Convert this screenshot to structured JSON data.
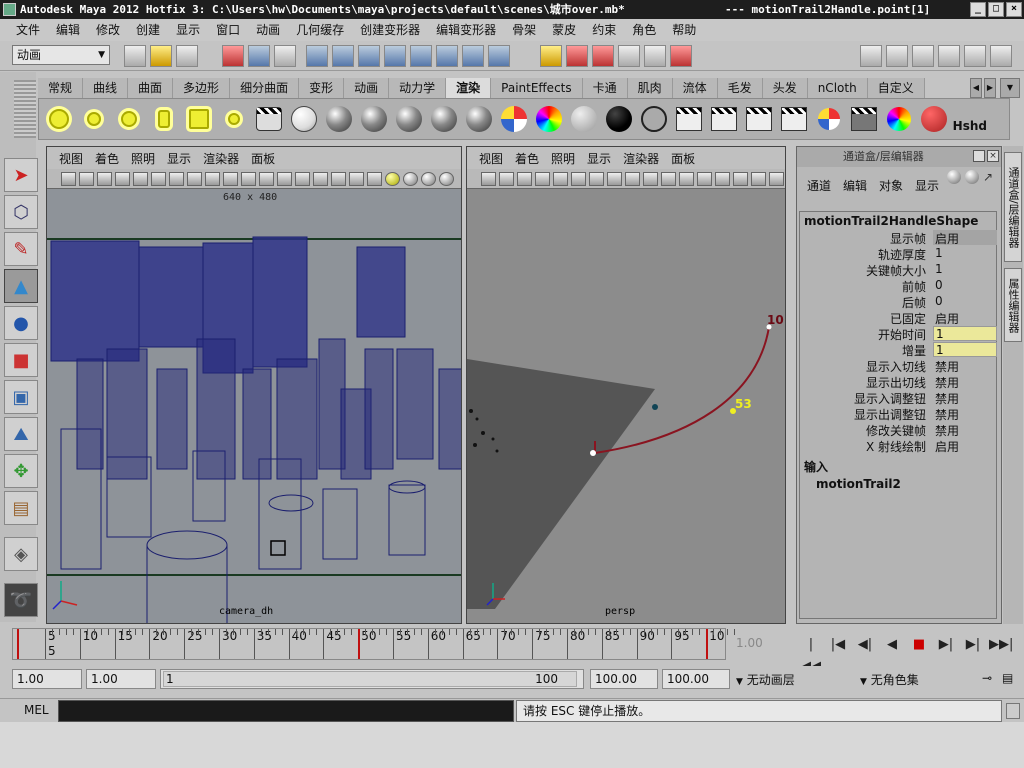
{
  "window": {
    "title": "Autodesk Maya 2012 Hotfix 3: C:\\Users\\hw\\Documents\\maya\\projects\\default\\scenes\\城市over.mb*",
    "title_extra": "---    motionTrail2Handle.point[1]",
    "controls": [
      "_",
      "□",
      "×"
    ]
  },
  "watermark": "新金桥 刘件通",
  "menu": [
    "文件",
    "编辑",
    "修改",
    "创建",
    "显示",
    "窗口",
    "动画",
    "几何缓存",
    "创建变形器",
    "编辑变形器",
    "骨架",
    "蒙皮",
    "约束",
    "角色",
    "帮助"
  ],
  "status_line": {
    "mode": "动画"
  },
  "shelf": {
    "tabs": [
      "常规",
      "曲线",
      "曲面",
      "多边形",
      "细分曲面",
      "变形",
      "动画",
      "动力学",
      "渲染",
      "PaintEffects",
      "卡通",
      "肌肉",
      "流体",
      "毛发",
      "头发",
      "nCloth",
      "自定义"
    ],
    "active_tab": "渲染",
    "last_icon_label": "Hshd"
  },
  "viewports": {
    "left": {
      "menu": [
        "视图",
        "着色",
        "照明",
        "显示",
        "渲染器",
        "面板"
      ],
      "resolution": "640 x 480",
      "camera": "camera_dh"
    },
    "right": {
      "menu": [
        "视图",
        "着色",
        "照明",
        "显示",
        "渲染器",
        "面板"
      ],
      "camera": "persp",
      "trail_labels": [
        "10",
        "53"
      ]
    }
  },
  "channel_box": {
    "title": "通道盒/层编辑器",
    "menu": [
      "通道",
      "编辑",
      "对象",
      "显示"
    ],
    "node": "motionTrail2HandleShape",
    "attributes": [
      {
        "name": "显示帧",
        "value": "启用",
        "style": "dk"
      },
      {
        "name": "轨迹厚度",
        "value": "1",
        "style": ""
      },
      {
        "name": "关键帧大小",
        "value": "1",
        "style": ""
      },
      {
        "name": "前帧",
        "value": "0",
        "style": ""
      },
      {
        "name": "后帧",
        "value": "0",
        "style": ""
      },
      {
        "name": "已固定",
        "value": "启用",
        "style": ""
      },
      {
        "name": "开始时间",
        "value": "1",
        "style": "hl"
      },
      {
        "name": "增量",
        "value": "1",
        "style": "hl"
      },
      {
        "name": "显示入切线",
        "value": "禁用",
        "style": ""
      },
      {
        "name": "显示出切线",
        "value": "禁用",
        "style": ""
      },
      {
        "name": "显示入调整钮",
        "value": "禁用",
        "style": ""
      },
      {
        "name": "显示出调整钮",
        "value": "禁用",
        "style": ""
      },
      {
        "name": "修改关键帧",
        "value": "禁用",
        "style": ""
      },
      {
        "name": "X 射线绘制",
        "value": "启用",
        "style": ""
      }
    ],
    "inputs_label": "输入",
    "input_node": "motionTrail2"
  },
  "side_tabs": [
    "通道盒/层编辑器",
    "属性编辑器"
  ],
  "time_slider": {
    "labels": [
      "5",
      "10",
      "15",
      "20",
      "25",
      "30",
      "35",
      "40",
      "45",
      "50",
      "55",
      "60",
      "65",
      "70",
      "75",
      "80",
      "85",
      "90",
      "95",
      "10"
    ],
    "current_frame_marker": "5",
    "current_time": "1.00",
    "keys": [
      1,
      50,
      100
    ]
  },
  "playback_buttons": [
    "|◀◀",
    "|◀",
    "◀|",
    "◀",
    "■",
    "▶|",
    "▶|",
    "▶▶|"
  ],
  "range": {
    "start_outer": "1.00",
    "start_inner": "1.00",
    "bar_start": "1",
    "bar_end": "100",
    "end_inner": "100.00",
    "end_outer": "100.00",
    "anim_layer": "无动画层",
    "character_set": "无角色集"
  },
  "command_line": {
    "label": "MEL",
    "output": "请按 ESC 键停止播放。"
  }
}
